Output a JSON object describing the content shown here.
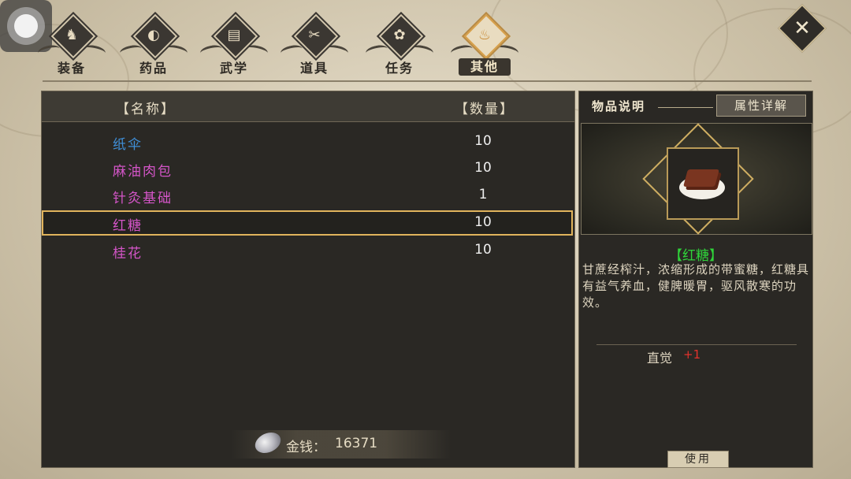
{
  "tabs": [
    {
      "label": "装备",
      "icon": "armor-icon",
      "glyph": "♞"
    },
    {
      "label": "药品",
      "icon": "medicine-icon",
      "glyph": "◐"
    },
    {
      "label": "武学",
      "icon": "book-icon",
      "glyph": "▤"
    },
    {
      "label": "道具",
      "icon": "tools-icon",
      "glyph": "✂"
    },
    {
      "label": "任务",
      "icon": "quest-icon",
      "glyph": "✿"
    },
    {
      "label": "其他",
      "icon": "flame-icon",
      "glyph": "♨"
    }
  ],
  "active_tab": "其他",
  "list": {
    "header_name": "【名称】",
    "header_qty": "【数量】",
    "items": [
      {
        "name": "纸伞",
        "qty": "10",
        "color": "#3f8fd8"
      },
      {
        "name": "麻油肉包",
        "qty": "10",
        "color": "#d455c8"
      },
      {
        "name": "针灸基础",
        "qty": "1",
        "color": "#d455c8"
      },
      {
        "name": "红糖",
        "qty": "10",
        "color": "#d455c8"
      },
      {
        "name": "桂花",
        "qty": "10",
        "color": "#d455c8"
      }
    ],
    "selected_index": 3
  },
  "gold": {
    "label": "金钱：",
    "value": "16371"
  },
  "detail": {
    "tab_desc": "物品说明",
    "tab_attr": "属性详解",
    "item_name": "【红糖】",
    "description": "甘蔗经榨汁，浓缩形成的带蜜糖，红糖具有益气养血，健脾暖胃，驱风散寒的功效。",
    "attribute": {
      "name": "直觉",
      "value": "+1"
    },
    "use_label": "使用"
  }
}
